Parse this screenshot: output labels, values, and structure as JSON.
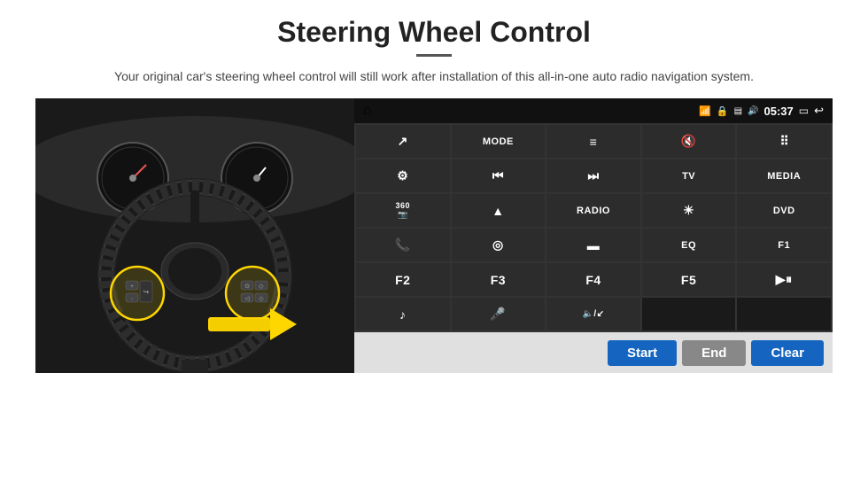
{
  "page": {
    "title": "Steering Wheel Control",
    "subtitle": "Your original car's steering wheel control will still work after installation of this all-in-one auto radio navigation system.",
    "title_underline": true
  },
  "status_bar": {
    "home_icon": "⌂",
    "wifi_icon": "wifi",
    "lock_icon": "🔒",
    "sd_icon": "SD",
    "bt_icon": "BT",
    "time": "05:37",
    "cast_icon": "cast",
    "back_icon": "↩"
  },
  "grid_buttons": [
    {
      "label": "↗",
      "type": "icon",
      "row": 1,
      "col": 1
    },
    {
      "label": "MODE",
      "type": "text",
      "row": 1,
      "col": 2
    },
    {
      "label": "≡",
      "type": "icon",
      "row": 1,
      "col": 3
    },
    {
      "label": "🔇",
      "type": "icon",
      "row": 1,
      "col": 4
    },
    {
      "label": "⠿",
      "type": "icon",
      "row": 1,
      "col": 5
    },
    {
      "label": "⚙",
      "type": "icon",
      "row": 2,
      "col": 1
    },
    {
      "label": "⏮",
      "type": "icon",
      "row": 2,
      "col": 2
    },
    {
      "label": "⏭",
      "type": "icon",
      "row": 2,
      "col": 3
    },
    {
      "label": "TV",
      "type": "text",
      "row": 2,
      "col": 4
    },
    {
      "label": "MEDIA",
      "type": "text",
      "row": 2,
      "col": 5
    },
    {
      "label": "360",
      "type": "text-small",
      "row": 3,
      "col": 1
    },
    {
      "label": "▲",
      "type": "icon",
      "row": 3,
      "col": 2
    },
    {
      "label": "RADIO",
      "type": "text",
      "row": 3,
      "col": 3
    },
    {
      "label": "☀",
      "type": "icon",
      "row": 3,
      "col": 4
    },
    {
      "label": "DVD",
      "type": "text",
      "row": 3,
      "col": 5
    },
    {
      "label": "📞",
      "type": "icon",
      "row": 4,
      "col": 1
    },
    {
      "label": "◎",
      "type": "icon",
      "row": 4,
      "col": 2
    },
    {
      "label": "▬",
      "type": "icon",
      "row": 4,
      "col": 3
    },
    {
      "label": "EQ",
      "type": "text",
      "row": 4,
      "col": 4
    },
    {
      "label": "F1",
      "type": "text",
      "row": 4,
      "col": 5
    },
    {
      "label": "F2",
      "type": "text",
      "row": 5,
      "col": 1
    },
    {
      "label": "F3",
      "type": "text",
      "row": 5,
      "col": 2
    },
    {
      "label": "F4",
      "type": "text",
      "row": 5,
      "col": 3
    },
    {
      "label": "F5",
      "type": "text",
      "row": 5,
      "col": 4
    },
    {
      "label": "▶⏸",
      "type": "icon",
      "row": 5,
      "col": 5
    },
    {
      "label": "♪",
      "type": "icon",
      "row": 6,
      "col": 1
    },
    {
      "label": "🎤",
      "type": "icon",
      "row": 6,
      "col": 2
    },
    {
      "label": "🔈/↙",
      "type": "icon",
      "row": 6,
      "col": 3
    },
    {
      "label": "",
      "type": "empty",
      "row": 6,
      "col": 4
    },
    {
      "label": "",
      "type": "empty",
      "row": 6,
      "col": 5
    }
  ],
  "bottom_bar": {
    "start_label": "Start",
    "end_label": "End",
    "clear_label": "Clear"
  }
}
